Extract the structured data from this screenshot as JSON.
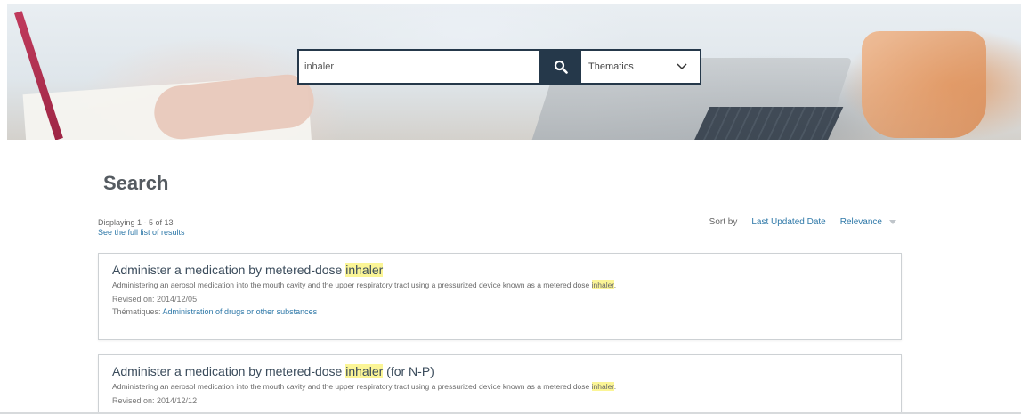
{
  "search": {
    "value": "inhaler",
    "placeholder": "",
    "thematics_label": "Thematics"
  },
  "page": {
    "title": "Search",
    "displaying": "Displaying 1 - 5 of 13",
    "full_list_link": "See the full list of results"
  },
  "sort": {
    "label": "Sort by",
    "options": [
      "Last Updated Date",
      "Relevance"
    ],
    "selected": "Relevance"
  },
  "results": [
    {
      "title_before": "Administer a medication by metered-dose ",
      "title_highlight": "inhaler",
      "title_after": "",
      "desc_before": "Administering an aerosol  medication  into the mouth cavity and the upper respiratory tract using a pressurized device known as a metered dose ",
      "desc_highlight": "inhaler",
      "desc_after": ".",
      "revised": "Revised on: 2014/12/05",
      "thematic_label": "Thématiques: ",
      "thematic_link": "Administration of drugs or other substances"
    },
    {
      "title_before": "Administer a medication by metered-dose ",
      "title_highlight": "inhaler",
      "title_after": " (for N-P)",
      "desc_before": "Administering an aerosol  medication  into the mouth cavity and the upper respiratory tract using a pressurized device known as a metered dose ",
      "desc_highlight": "inhaler",
      "desc_after": ".",
      "revised": "Revised on: 2014/12/12"
    }
  ],
  "colors": {
    "navy": "#25384a",
    "link": "#2e78a8",
    "highlight": "#fbf596"
  },
  "icons": {
    "search": "search-icon",
    "dropdown": "chevron-down-icon",
    "sort_caret": "caret-down-icon"
  }
}
